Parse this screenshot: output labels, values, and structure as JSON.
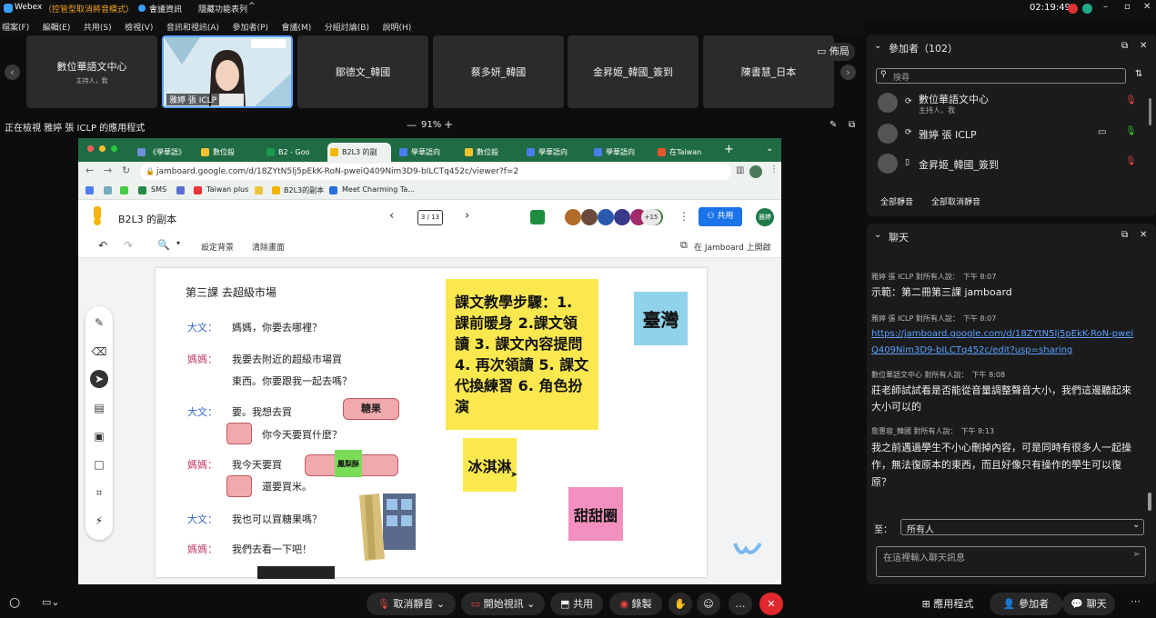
{
  "window": {
    "app": "Webex",
    "mode": "（控管型取消將音模式）",
    "meeting_info": "會議資訊",
    "hide_bar": "隱藏功能表列",
    "time": "02:19:49"
  },
  "menu": [
    "檔案(F)",
    "編輯(E)",
    "共用(S)",
    "檢視(V)",
    "音訊和視訊(A)",
    "參加者(P)",
    "會議(M)",
    "分組討論(B)",
    "說明(H)"
  ],
  "strip": {
    "tiles": [
      {
        "name": "數位華語文中心",
        "sub": "主持人，我"
      },
      {
        "name": "雅婷 張 ICLP",
        "sub": ""
      },
      {
        "name": "鄒德文_韓國",
        "sub": ""
      },
      {
        "name": "蔡多妍_韓國",
        "sub": ""
      },
      {
        "name": "金昇姬_韓國_簽到",
        "sub": ""
      },
      {
        "name": "陳書慧_日本",
        "sub": ""
      }
    ],
    "layout_label": "佈局"
  },
  "share": {
    "viewing": "正在檢視 雅婷 張 ICLP 的應用程式",
    "zoom": "91%",
    "minus": "—",
    "plus": "+"
  },
  "browser": {
    "tabs": [
      "《學華語》",
      "數位殺",
      "B2 - Goo",
      "B2L3 的副",
      "學華語向",
      "數位殺",
      "學華語向",
      "學華語向",
      "在Taiwan"
    ],
    "new_tab": "+",
    "url": "jamboard.google.com/d/18ZYtN5lj5pEkK-RoN-pweiQ409Nim3D9-bILCTq452c/viewer?f=2",
    "bookmarks": [
      "SMS",
      "Taiwan plus",
      "B2L3的副本",
      "Meet Charming Ta..."
    ]
  },
  "jamboard": {
    "title": "B2L3 的副本",
    "page": "3 / 13",
    "share": "共用",
    "avatar": "雅婷",
    "extra_count": "+15",
    "tools": [
      "設定背景",
      "清除畫面"
    ],
    "open": "在 Jamboard 上開啟"
  },
  "lesson": {
    "heading": "第三課 去超級市場",
    "lines": [
      {
        "speaker": "大文：",
        "text": "媽媽，你要去哪裡？"
      },
      {
        "speaker": "媽媽：",
        "text": "我要去附近的超級市場買"
      },
      {
        "speaker": "",
        "text": "東西。你要跟我一起去嗎？"
      },
      {
        "speaker": "大文：",
        "text": "要。我想去買"
      },
      {
        "speaker": "",
        "text": "你今天要買什麼？"
      },
      {
        "speaker": "媽媽：",
        "text": "我今天要買"
      },
      {
        "speaker": "",
        "text": "還要買米。"
      },
      {
        "speaker": "大文：",
        "text": "我也可以買糖果嗎？"
      },
      {
        "speaker": "媽媽：",
        "text": "我們去看一下吧！"
      }
    ],
    "labels": {
      "candy": "糖果",
      "pineapple": "鳳梨酥"
    }
  },
  "stickies": {
    "steps": "課文教學步驟：1. 課前暖身 2.課文領讀 3. 課文內容提問 4. 再次領讀 5. 課文代換練習 6. 角色扮演",
    "taiwan": "臺灣",
    "icecream": "冰淇淋",
    "donut": "甜甜圈"
  },
  "participants": {
    "header": "參加者（102）",
    "search": "搜尋",
    "list": [
      {
        "name": "數位華語文中心",
        "sub": "主持人，我"
      },
      {
        "name": "雅婷 張 ICLP",
        "sub": ""
      },
      {
        "name": "金昇姬_韓國_簽到",
        "sub": ""
      }
    ],
    "mute_all": "全部靜音",
    "unmute_all": "全部取消靜音"
  },
  "chat": {
    "header": "聊天",
    "messages": [
      {
        "from": "雅婷 張 ICLP 對所有人說：",
        "time": "下午 8:07",
        "text": "示範：第二冊第三課 jamboard",
        "link": false
      },
      {
        "from": "雅婷 張 ICLP 對所有人說：",
        "time": "下午 8:07",
        "text": "https://jamboard.google.com/d/18ZYtN5lj5pEkK-RoN-pweiQ409Nim3D9-bILCTq452c/edit?usp=sharing",
        "link": true
      },
      {
        "from": "數位華語文中心 對所有人說：",
        "time": "下午 8:08",
        "text": "莊老師試試看是否能從音量調整聲音大小，我們這邊聽起來大小可以的",
        "link": false
      },
      {
        "from": "詹惠容_韓國 對所有人說：",
        "time": "下午 8:13",
        "text": "我之前遇過學生不小心刪掉內容，可是同時有很多人一起操作，無法復原本的東西，而且好像只有操作的學生可以復原？",
        "link": false
      }
    ],
    "to_label": "至：",
    "to_value": "所有人",
    "placeholder": "在這裡輸入聊天訊息"
  },
  "controls": {
    "mute": "取消靜音",
    "video": "開始視訊",
    "share": "共用",
    "record": "錄製",
    "more": "…",
    "apps": "應用程式",
    "participants": "參加者",
    "chat": "聊天"
  }
}
